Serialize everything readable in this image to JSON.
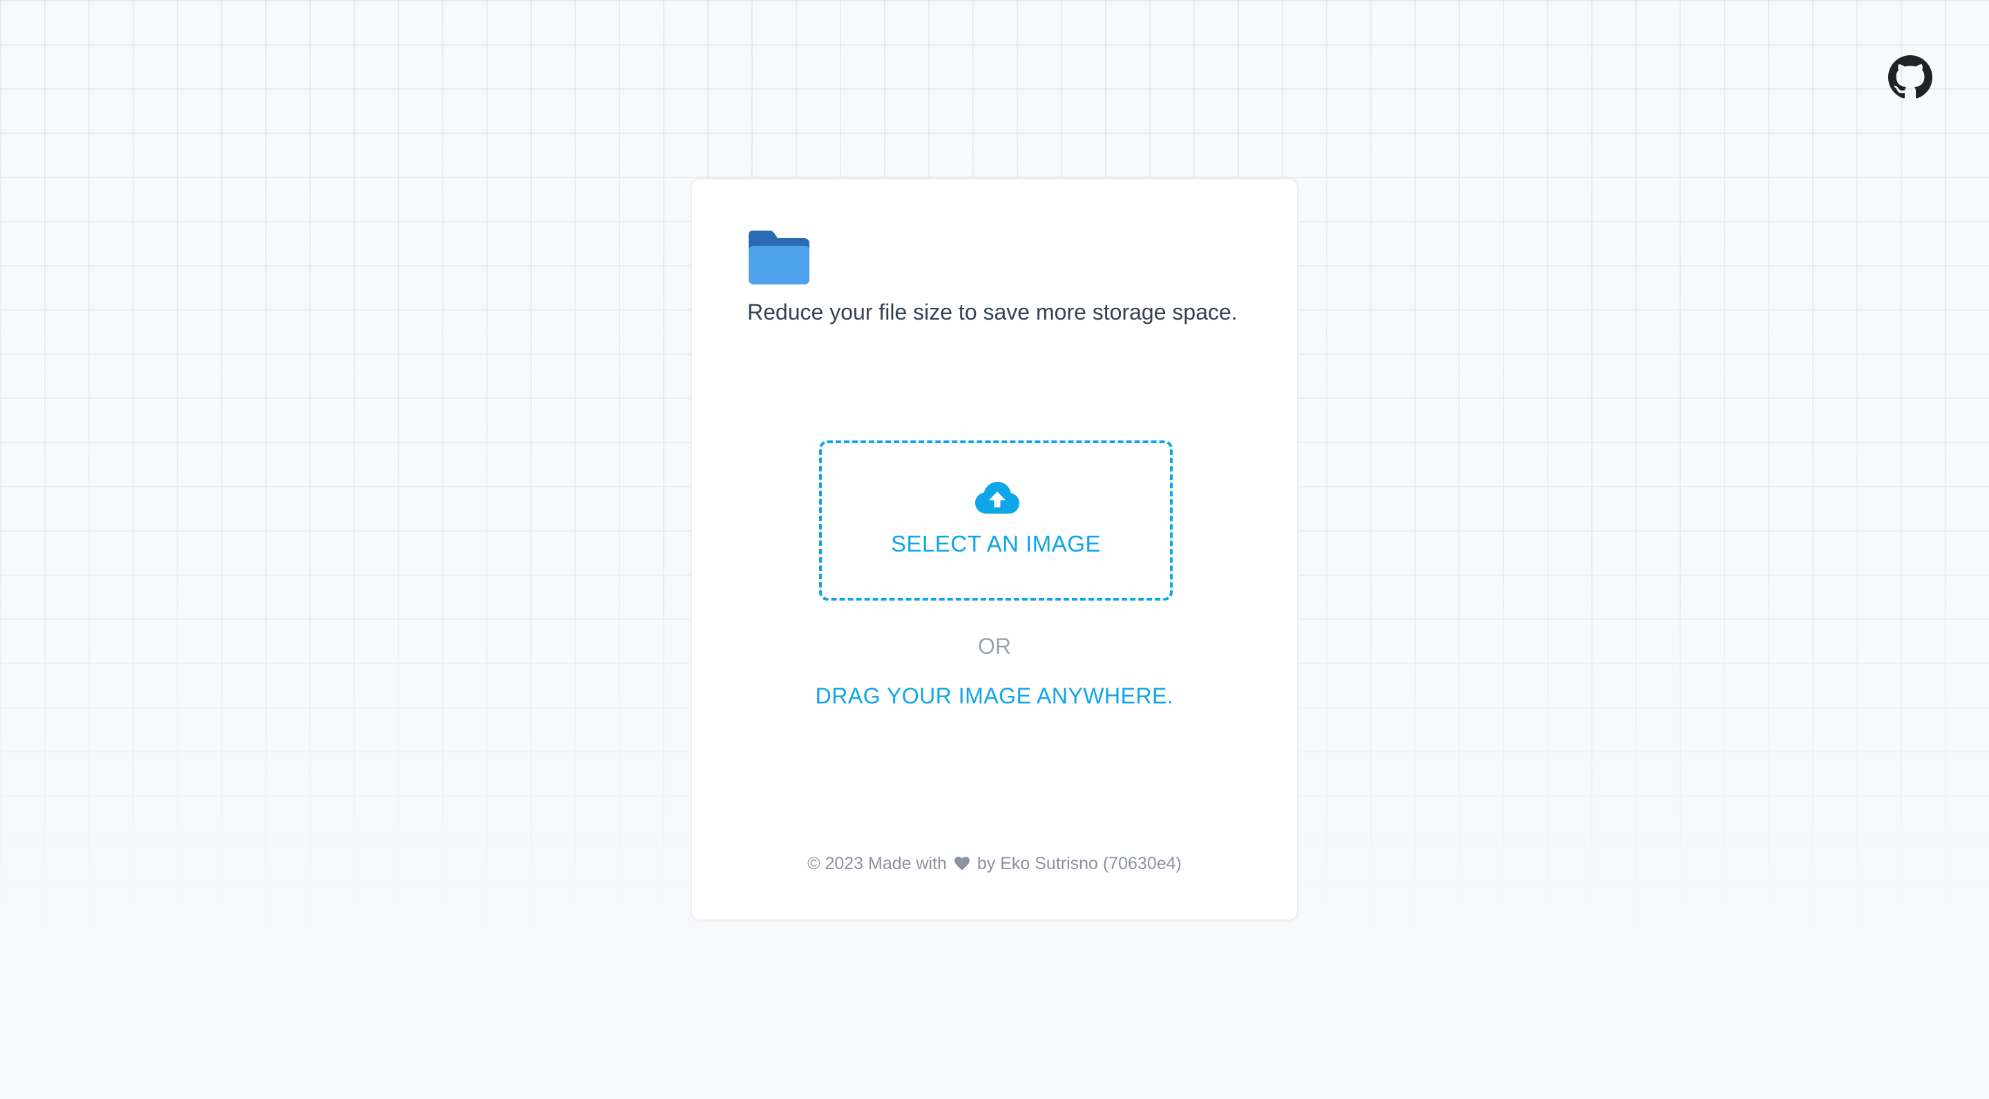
{
  "header": {
    "github_icon": "github-icon"
  },
  "card": {
    "folder_icon": "folder-icon",
    "tagline": "Reduce your file size to save more storage space.",
    "upload": {
      "icon": "cloud-upload-icon",
      "label": "SELECT AN IMAGE"
    },
    "or_text": "OR",
    "drag_text": "DRAG YOUR IMAGE ANYWHERE."
  },
  "footer": {
    "prefix": "© 2023 Made with",
    "heart_icon": "heart-icon",
    "suffix": "by Eko Sutrisno (70630e4)"
  },
  "colors": {
    "accent": "#0ea5e9",
    "folder_back": "#2a6bb3",
    "folder_front": "#4fa3ec",
    "text_primary": "#374151",
    "text_muted": "#9ca3af",
    "page_background": "#f8f9fb"
  }
}
